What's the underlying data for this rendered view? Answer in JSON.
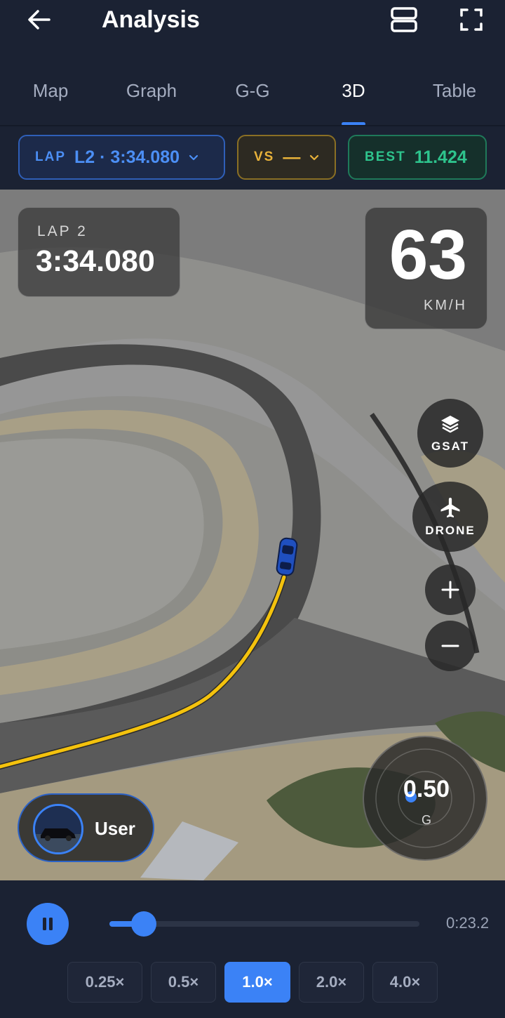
{
  "header": {
    "title": "Analysis",
    "back_icon": "arrow-left-icon",
    "layout_icon": "split-view-icon",
    "fullscreen_icon": "fullscreen-icon"
  },
  "tabs": [
    {
      "label": "Map",
      "active": false
    },
    {
      "label": "Graph",
      "active": false
    },
    {
      "label": "G-G",
      "active": false
    },
    {
      "label": "3D",
      "active": true
    },
    {
      "label": "Table",
      "active": false
    }
  ],
  "lap_bar": {
    "lap_key": "LAP",
    "lap_value": "L2 · 3:34.080",
    "vs_key": "VS",
    "vs_value": "—",
    "best_key": "BEST",
    "best_value": "11.424",
    "colors": {
      "lap": "#4c8ff5",
      "vs": "#e8b23a",
      "best": "#2ec48d"
    }
  },
  "map": {
    "lap_card": {
      "label": "LAP 2",
      "time": "3:34.080"
    },
    "speed": {
      "value": "63",
      "unit": "KM/H"
    },
    "buttons": {
      "gsat": {
        "label": "GSAT",
        "icon": "layers-icon"
      },
      "drone": {
        "label": "DRONE",
        "icon": "airplane-icon"
      },
      "zoom_in_icon": "plus-icon",
      "zoom_out_icon": "minus-icon"
    },
    "user": {
      "name": "User"
    },
    "g_meter": {
      "value": "0.50",
      "unit": "G"
    },
    "racing_line_color": "#f4c20d"
  },
  "player": {
    "state": "playing",
    "progress": 0.11,
    "time": "0:23.2",
    "speeds": [
      {
        "label": "0.25×",
        "active": false
      },
      {
        "label": "0.5×",
        "active": false
      },
      {
        "label": "1.0×",
        "active": true
      },
      {
        "label": "2.0×",
        "active": false
      },
      {
        "label": "4.0×",
        "active": false
      }
    ],
    "accent": "#3b82f6"
  }
}
